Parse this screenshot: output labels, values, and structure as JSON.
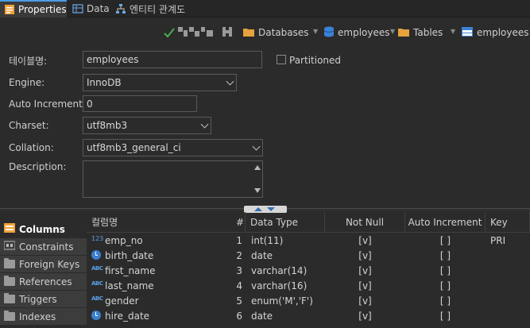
{
  "tabs": [
    {
      "label": "Properties",
      "active": true
    },
    {
      "label": "Data",
      "active": false
    },
    {
      "label": "엔티티 관계도",
      "active": false
    }
  ],
  "breadcrumb": {
    "databases": "Databases",
    "database": "employees",
    "tables": "Tables",
    "table": "employees"
  },
  "form": {
    "table_name_label": "테이블명:",
    "table_name": "employees",
    "engine_label": "Engine:",
    "engine": "InnoDB",
    "auto_increment_label": "Auto Increment:",
    "auto_increment": "0",
    "charset_label": "Charset:",
    "charset": "utf8mb3",
    "collation_label": "Collation:",
    "collation": "utf8mb3_general_ci",
    "description_label": "Description:",
    "description": "",
    "partitioned_label": "Partitioned"
  },
  "sidebar": {
    "items": [
      {
        "label": "Columns",
        "active": true
      },
      {
        "label": "Constraints",
        "active": false
      },
      {
        "label": "Foreign Keys",
        "active": false
      },
      {
        "label": "References",
        "active": false
      },
      {
        "label": "Triggers",
        "active": false
      },
      {
        "label": "Indexes",
        "active": false
      }
    ]
  },
  "columns_table": {
    "headers": [
      "컬럼명",
      "#",
      "Data Type",
      "Not Null",
      "Auto Increment",
      "Key"
    ],
    "rows": [
      {
        "icon": "numeric-key-icon",
        "name": "emp_no",
        "num": "1",
        "type": "int(11)",
        "not_null": "[v]",
        "auto_inc": "[ ]",
        "key": "PRI"
      },
      {
        "icon": "clock-icon",
        "name": "birth_date",
        "num": "2",
        "type": "date",
        "not_null": "[v]",
        "auto_inc": "[ ]",
        "key": ""
      },
      {
        "icon": "abc-icon",
        "name": "first_name",
        "num": "3",
        "type": "varchar(14)",
        "not_null": "[v]",
        "auto_inc": "[ ]",
        "key": ""
      },
      {
        "icon": "abc-icon",
        "name": "last_name",
        "num": "4",
        "type": "varchar(16)",
        "not_null": "[v]",
        "auto_inc": "[ ]",
        "key": ""
      },
      {
        "icon": "abc-icon",
        "name": "gender",
        "num": "5",
        "type": "enum('M','F')",
        "not_null": "[v]",
        "auto_inc": "[ ]",
        "key": ""
      },
      {
        "icon": "clock-icon",
        "name": "hire_date",
        "num": "6",
        "type": "date",
        "not_null": "[v]",
        "auto_inc": "[ ]",
        "key": ""
      }
    ]
  },
  "colors": {
    "background": "#2b2b2b",
    "accent": "#4a9ee6",
    "folder": "#e6a23c",
    "db_icon": "#3b82d6"
  }
}
